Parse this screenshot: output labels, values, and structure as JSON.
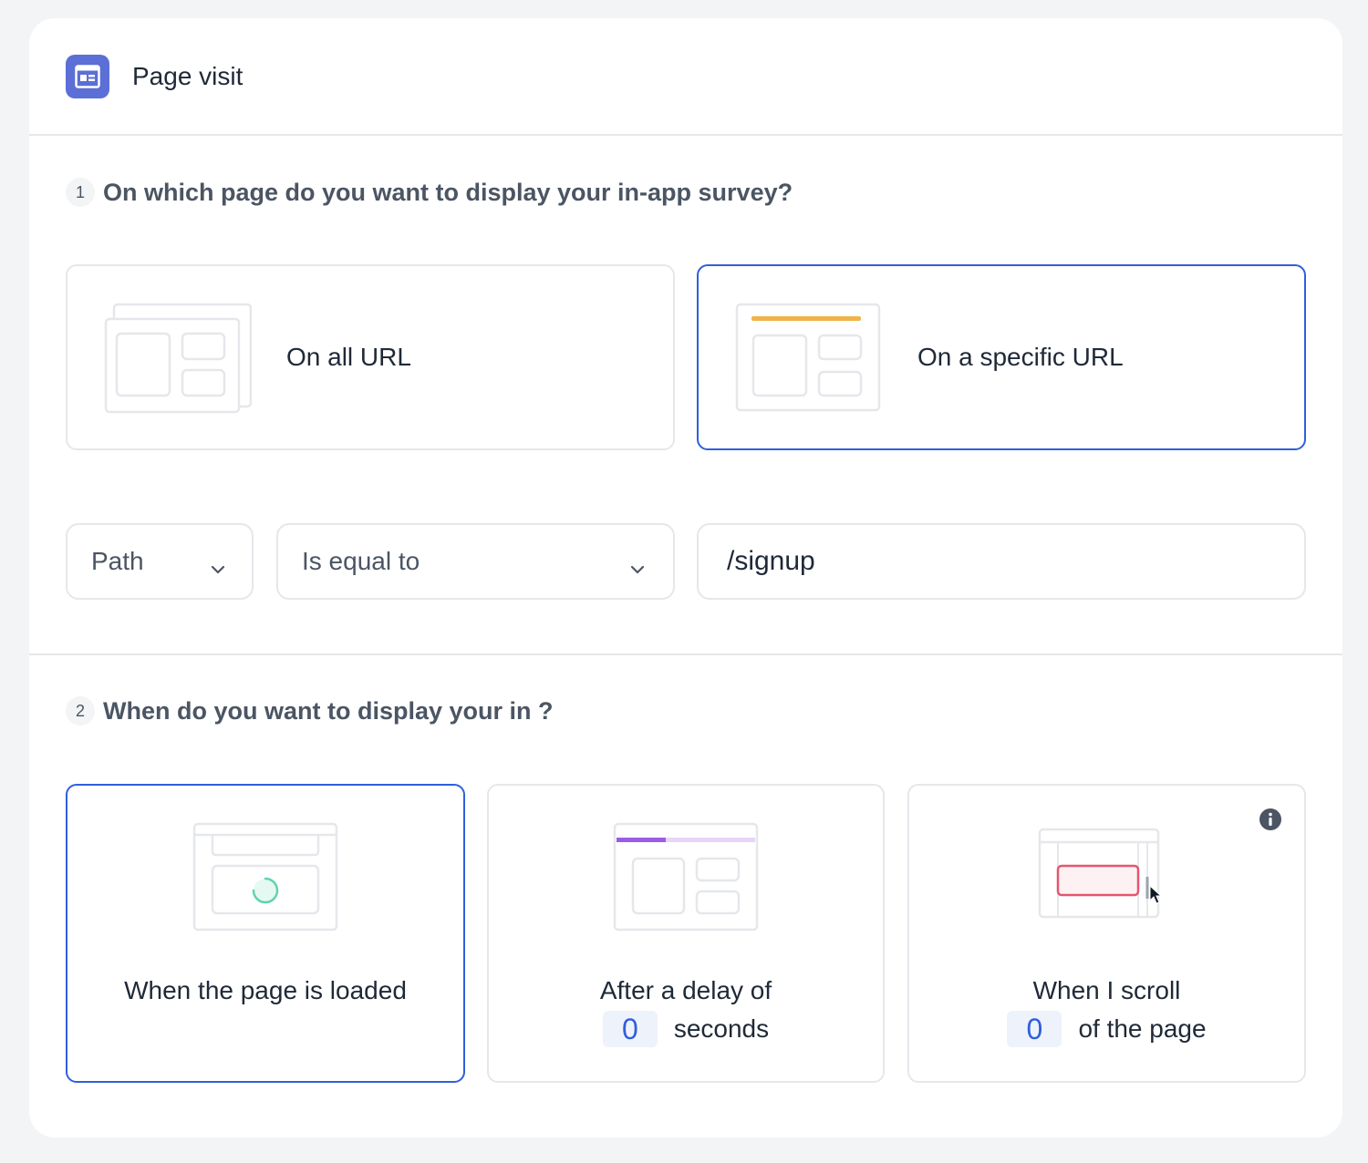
{
  "header": {
    "title": "Page visit",
    "icon": "browser-window-icon",
    "icon_color": "#5b6fd6"
  },
  "section1": {
    "step": "1",
    "question": "On which page do you want to display your in-app survey?",
    "options": [
      {
        "label": "On all URL",
        "selected": false,
        "icon": "stacked-windows-icon"
      },
      {
        "label": "On a specific URL",
        "selected": true,
        "icon": "highlighted-window-icon"
      }
    ],
    "path_select": {
      "value": "Path"
    },
    "operator_select": {
      "value": "Is equal to"
    },
    "url_input": {
      "value": "/signup"
    }
  },
  "section2": {
    "step": "2",
    "question": "When do you want to display your in ?",
    "options": [
      {
        "label": "When the page is loaded",
        "selected": true,
        "icon": "page-loading-icon"
      },
      {
        "label_before": "After a delay of",
        "value": "0",
        "label_after": "seconds",
        "selected": false,
        "icon": "delay-progress-icon"
      },
      {
        "label_before": "When I scroll",
        "value": "0",
        "label_after": "of the page",
        "selected": false,
        "icon": "scroll-cursor-icon"
      }
    ],
    "info_icon": "info-icon"
  },
  "colors": {
    "selected_border": "#2f5fdc",
    "accent_yellow": "#f0b34a",
    "accent_purple": "#9b5de5",
    "accent_green": "#5fd4b0",
    "accent_red": "#e5566f"
  }
}
